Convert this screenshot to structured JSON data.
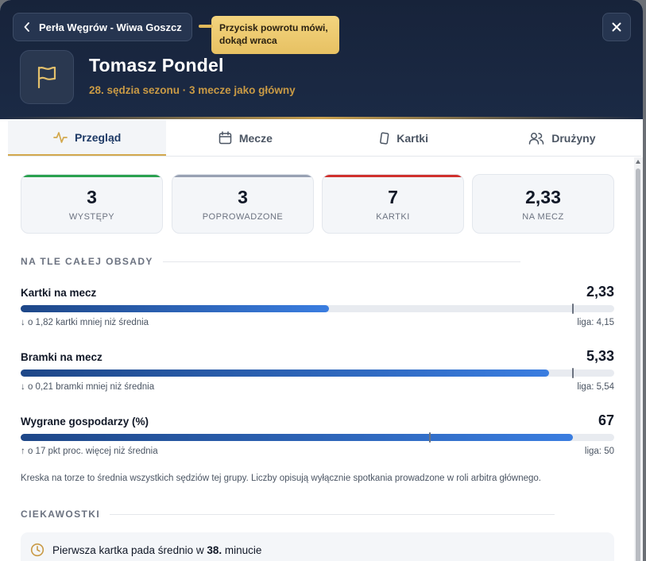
{
  "header": {
    "back_label": "Perła Węgrów - Wiwa Goszcz",
    "tooltip": "Przycisk powrotu mówi, dokąd wraca",
    "name": "Tomasz Pondel",
    "subtitle": "28. sędzia sezonu · 3 mecze jako główny",
    "avatar_icon": "flag-icon",
    "close_icon": "close-icon"
  },
  "tabs": [
    {
      "label": "Przegląd",
      "icon": "activity-icon",
      "active": true
    },
    {
      "label": "Mecze",
      "icon": "calendar-icon",
      "active": false
    },
    {
      "label": "Kartki",
      "icon": "card-icon",
      "active": false
    },
    {
      "label": "Drużyny",
      "icon": "users-icon",
      "active": false
    }
  ],
  "stats": [
    {
      "value": "3",
      "label": "WYSTĘPY",
      "color": "#2aa14f"
    },
    {
      "value": "3",
      "label": "POPROWADZONE",
      "color": "#98a1b3"
    },
    {
      "value": "7",
      "label": "KARTKI",
      "color": "#d0312d"
    },
    {
      "value": "2,33",
      "label": "NA MECZ",
      "color": ""
    }
  ],
  "comparison": {
    "title": "NA TLE CAŁEJ OBSADY",
    "metrics": [
      {
        "label": "Kartki na mecz",
        "value": "2,33",
        "diff_arrow": "↓",
        "diff": "o 1,82 kartki mniej niż średnia",
        "league": "liga: 4,15",
        "fill_pct": 52,
        "avg_pct": 93
      },
      {
        "label": "Bramki na mecz",
        "value": "5,33",
        "diff_arrow": "↓",
        "diff": "o 0,21 bramki mniej niż średnia",
        "league": "liga: 5,54",
        "fill_pct": 89,
        "avg_pct": 93
      },
      {
        "label": "Wygrane gospodarzy (%)",
        "value": "67",
        "diff_arrow": "↑",
        "diff": "o 17 pkt proc. więcej niż średnia",
        "league": "liga: 50",
        "fill_pct": 93,
        "avg_pct": 69
      }
    ],
    "note": "Kreska na torze to średnia wszystkich sędziów tej grupy. Liczby opisują wyłącznie spotkania prowadzone w roli arbitra głównego."
  },
  "facts": {
    "title": "CIEKAWOSTKI",
    "items": [
      {
        "icon": "clock-icon",
        "text_before": "Pierwsza kartka pada średnio w ",
        "highlight": "38.",
        "text_after": " minucie"
      }
    ]
  }
}
